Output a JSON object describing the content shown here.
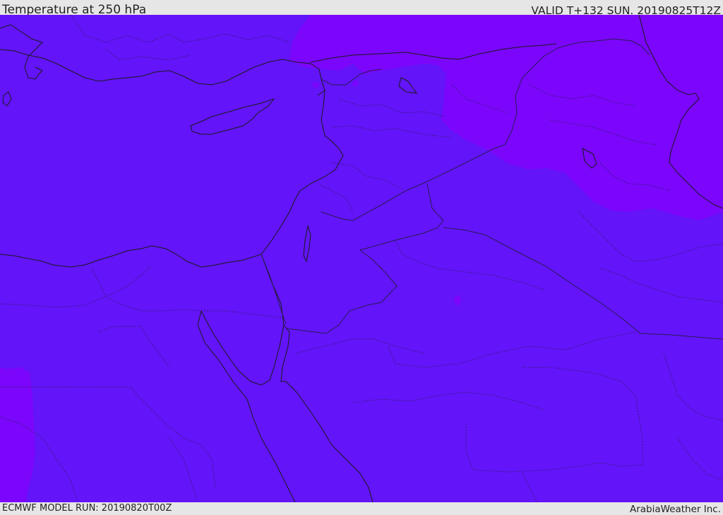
{
  "header": {
    "title": "Temperature at 250 hPa",
    "valid_time": "VALID T+132 SUN. 20190825T12Z"
  },
  "footer": {
    "model_run": "ECMWF MODEL RUN: 20190820T00Z",
    "credit": "ArabiaWeather Inc."
  },
  "colors": {
    "frame_background": "#e6e6e6",
    "temperature_band_main": "#6314f8",
    "temperature_band_cold": "#7b06fb",
    "coastline": "#1a1a1a",
    "border": "#2a1a55"
  },
  "map": {
    "variable": "temperature",
    "level": "250 hPa",
    "region": "Eastern Mediterranean & Middle East",
    "fill_bands": [
      "temperature_band_main",
      "temperature_band_cold"
    ]
  }
}
